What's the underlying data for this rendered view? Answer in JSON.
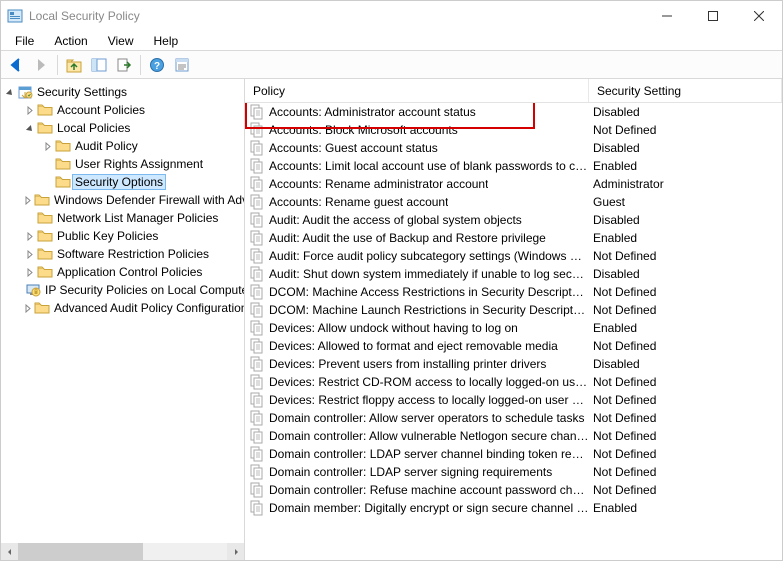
{
  "window": {
    "title": "Local Security Policy"
  },
  "menu": {
    "items": [
      "File",
      "Action",
      "View",
      "Help"
    ]
  },
  "tree": {
    "root": "Security Settings",
    "nodes": [
      {
        "label": "Account Policies",
        "indent": 1,
        "expander": "closed",
        "icon": "folder"
      },
      {
        "label": "Local Policies",
        "indent": 1,
        "expander": "open",
        "icon": "folder"
      },
      {
        "label": "Audit Policy",
        "indent": 2,
        "expander": "closed",
        "icon": "folder"
      },
      {
        "label": "User Rights Assignment",
        "indent": 2,
        "expander": "none",
        "icon": "folder"
      },
      {
        "label": "Security Options",
        "indent": 2,
        "expander": "none",
        "icon": "folder",
        "selected": true
      },
      {
        "label": "Windows Defender Firewall with Advanced Security",
        "indent": 1,
        "expander": "closed",
        "icon": "folder"
      },
      {
        "label": "Network List Manager Policies",
        "indent": 1,
        "expander": "none",
        "icon": "folder"
      },
      {
        "label": "Public Key Policies",
        "indent": 1,
        "expander": "closed",
        "icon": "folder"
      },
      {
        "label": "Software Restriction Policies",
        "indent": 1,
        "expander": "closed",
        "icon": "folder"
      },
      {
        "label": "Application Control Policies",
        "indent": 1,
        "expander": "closed",
        "icon": "folder"
      },
      {
        "label": "IP Security Policies on Local Computer",
        "indent": 1,
        "expander": "none",
        "icon": "ipsec"
      },
      {
        "label": "Advanced Audit Policy Configuration",
        "indent": 1,
        "expander": "closed",
        "icon": "folder"
      }
    ]
  },
  "list": {
    "headers": {
      "policy": "Policy",
      "setting": "Security Setting"
    },
    "rows": [
      {
        "policy": "Accounts: Administrator account status",
        "setting": "Disabled",
        "highlighted": true
      },
      {
        "policy": "Accounts: Block Microsoft accounts",
        "setting": "Not Defined"
      },
      {
        "policy": "Accounts: Guest account status",
        "setting": "Disabled"
      },
      {
        "policy": "Accounts: Limit local account use of blank passwords to co...",
        "setting": "Enabled"
      },
      {
        "policy": "Accounts: Rename administrator account",
        "setting": "Administrator"
      },
      {
        "policy": "Accounts: Rename guest account",
        "setting": "Guest"
      },
      {
        "policy": "Audit: Audit the access of global system objects",
        "setting": "Disabled"
      },
      {
        "policy": "Audit: Audit the use of Backup and Restore privilege",
        "setting": "Enabled"
      },
      {
        "policy": "Audit: Force audit policy subcategory settings (Windows Vis...",
        "setting": "Not Defined"
      },
      {
        "policy": "Audit: Shut down system immediately if unable to log secur...",
        "setting": "Disabled"
      },
      {
        "policy": "DCOM: Machine Access Restrictions in Security Descriptor D...",
        "setting": "Not Defined"
      },
      {
        "policy": "DCOM: Machine Launch Restrictions in Security Descriptor ...",
        "setting": "Not Defined"
      },
      {
        "policy": "Devices: Allow undock without having to log on",
        "setting": "Enabled"
      },
      {
        "policy": "Devices: Allowed to format and eject removable media",
        "setting": "Not Defined"
      },
      {
        "policy": "Devices: Prevent users from installing printer drivers",
        "setting": "Disabled"
      },
      {
        "policy": "Devices: Restrict CD-ROM access to locally logged-on user ...",
        "setting": "Not Defined"
      },
      {
        "policy": "Devices: Restrict floppy access to locally logged-on user only",
        "setting": "Not Defined"
      },
      {
        "policy": "Domain controller: Allow server operators to schedule tasks",
        "setting": "Not Defined"
      },
      {
        "policy": "Domain controller: Allow vulnerable Netlogon secure chann...",
        "setting": "Not Defined"
      },
      {
        "policy": "Domain controller: LDAP server channel binding token requi...",
        "setting": "Not Defined"
      },
      {
        "policy": "Domain controller: LDAP server signing requirements",
        "setting": "Not Defined"
      },
      {
        "policy": "Domain controller: Refuse machine account password chan...",
        "setting": "Not Defined"
      },
      {
        "policy": "Domain member: Digitally encrypt or sign secure channel d...",
        "setting": "Enabled"
      }
    ]
  }
}
